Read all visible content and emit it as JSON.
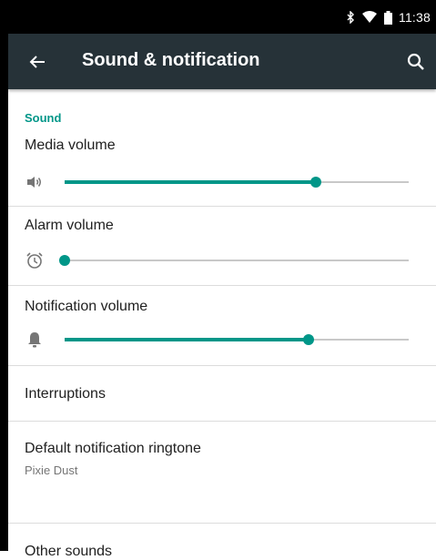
{
  "status_bar": {
    "time": "11:38",
    "icons": [
      "bluetooth-icon",
      "wifi-icon",
      "battery-icon"
    ]
  },
  "app_bar": {
    "title": "Sound & notification",
    "back_icon": "arrow-back-icon",
    "search_icon": "search-icon"
  },
  "colors": {
    "accent": "#009688",
    "app_bar": "#263238",
    "status_bar": "#000000"
  },
  "section": {
    "header": "Sound"
  },
  "volumes": [
    {
      "label": "Media volume",
      "icon": "speaker-icon",
      "level": 0.73
    },
    {
      "label": "Alarm volume",
      "icon": "alarm-clock-icon",
      "level": 0.0
    },
    {
      "label": "Notification volume",
      "icon": "bell-icon",
      "level": 0.71
    }
  ],
  "prefs": [
    {
      "title": "Interruptions"
    },
    {
      "title": "Default notification ringtone",
      "summary": "Pixie Dust"
    },
    {
      "title": "Other sounds"
    }
  ]
}
